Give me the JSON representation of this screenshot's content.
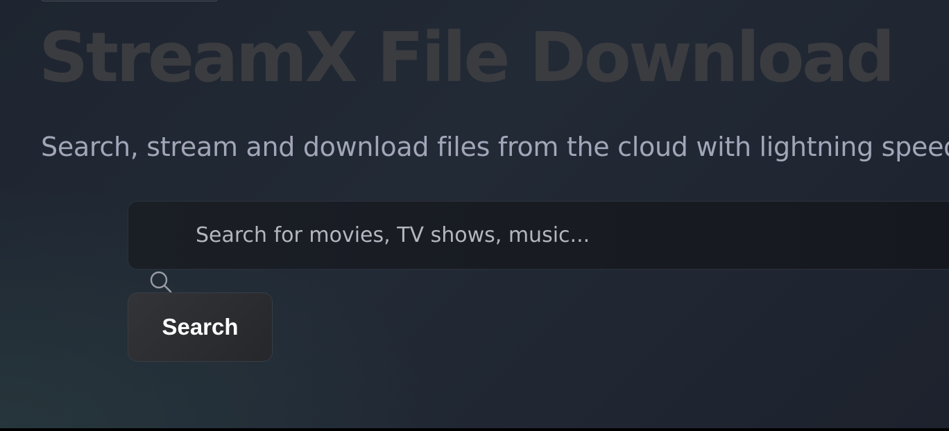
{
  "hero": {
    "title": "StreamX File Download",
    "subtitle": "Search, stream and download files from the cloud with lightning speed"
  },
  "search": {
    "placeholder": "Search for movies, TV shows, music...",
    "value": "",
    "button_label": "Search",
    "icon": "search-icon"
  },
  "colors": {
    "title": "#3b3c40",
    "subtitle": "#a3a6b8",
    "button_text": "#ffffff"
  }
}
